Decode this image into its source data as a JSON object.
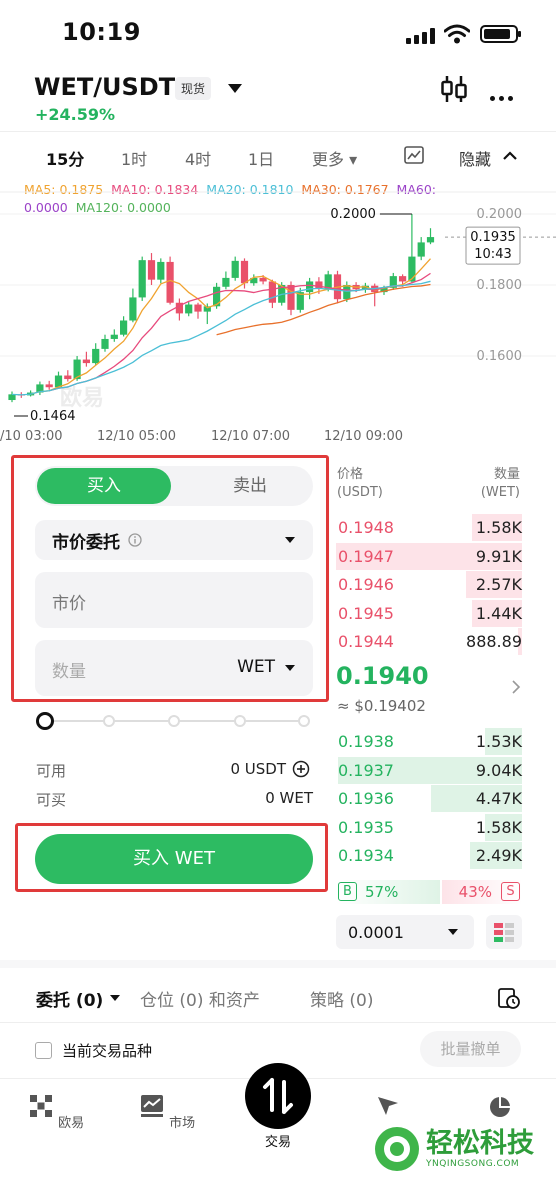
{
  "status": {
    "time": "10:19"
  },
  "header": {
    "pair": "WET/USDT",
    "badge": "现货",
    "change": "+24.59%"
  },
  "timeframes": [
    "15分",
    "1时",
    "4时",
    "1日",
    "更多 ▾"
  ],
  "hide_label": "隐藏",
  "ma": {
    "ma5": "MA5: 0.1875",
    "ma10": "MA10: 0.1834",
    "ma20": "MA20: 0.1810",
    "ma30": "MA30: 0.1767",
    "ma60_a": "MA60:",
    "ma60_b": "0.0000",
    "ma120": "MA120: 0.0000"
  },
  "colors": {
    "green": "#2dbb62",
    "red": "#e9516a",
    "ma5": "#f0a330",
    "ma10": "#e74a7d",
    "ma20": "#4bbfd6",
    "ma30": "#e8712c",
    "ma60": "#9b43c8",
    "ma120": "#54b35b"
  },
  "chart_data": {
    "type": "candlestick",
    "y_ticks": [
      "0.2000",
      "0.1800",
      "0.1600"
    ],
    "x_ticks": [
      "/10 03:00",
      "12/10 05:00",
      "12/10 07:00",
      "12/10 09:00"
    ],
    "high_label": "0.2000",
    "low_label": "0.1464",
    "price_tag": "0.1935",
    "countdown": "10:43",
    "watermark": "欧易",
    "candles": [
      [
        0.1476,
        0.1492,
        0.15,
        0.147
      ],
      [
        0.1492,
        0.1489,
        0.1498,
        0.1482
      ],
      [
        0.1489,
        0.1497,
        0.1503,
        0.1486
      ],
      [
        0.1497,
        0.152,
        0.1528,
        0.149
      ],
      [
        0.152,
        0.1512,
        0.153,
        0.1505
      ],
      [
        0.1512,
        0.1545,
        0.1556,
        0.1508
      ],
      [
        0.1545,
        0.1535,
        0.156,
        0.1528
      ],
      [
        0.1535,
        0.159,
        0.16,
        0.153
      ],
      [
        0.159,
        0.158,
        0.1612,
        0.157
      ],
      [
        0.158,
        0.162,
        0.1636,
        0.1575
      ],
      [
        0.162,
        0.1648,
        0.166,
        0.1612
      ],
      [
        0.1648,
        0.166,
        0.1675,
        0.164
      ],
      [
        0.166,
        0.17,
        0.1712,
        0.1655
      ],
      [
        0.17,
        0.1765,
        0.179,
        0.1695
      ],
      [
        0.1765,
        0.187,
        0.188,
        0.1755
      ],
      [
        0.187,
        0.1815,
        0.189,
        0.18
      ],
      [
        0.1815,
        0.1865,
        0.1875,
        0.1805
      ],
      [
        0.1865,
        0.175,
        0.188,
        0.1745
      ],
      [
        0.175,
        0.172,
        0.1762,
        0.17
      ],
      [
        0.172,
        0.1745,
        0.1752,
        0.1712
      ],
      [
        0.1745,
        0.1725,
        0.175,
        0.1705
      ],
      [
        0.1725,
        0.174,
        0.1748,
        0.169
      ],
      [
        0.174,
        0.1795,
        0.1806,
        0.1733
      ],
      [
        0.1795,
        0.182,
        0.1838,
        0.1788
      ],
      [
        0.182,
        0.1868,
        0.188,
        0.1812
      ],
      [
        0.1868,
        0.1805,
        0.1875,
        0.179
      ],
      [
        0.1805,
        0.182,
        0.183,
        0.1798
      ],
      [
        0.182,
        0.181,
        0.1828,
        0.1802
      ],
      [
        0.181,
        0.175,
        0.1815,
        0.1735
      ],
      [
        0.175,
        0.18,
        0.1808,
        0.1742
      ],
      [
        0.18,
        0.173,
        0.181,
        0.1715
      ],
      [
        0.173,
        0.178,
        0.1792,
        0.1722
      ],
      [
        0.178,
        0.181,
        0.182,
        0.176
      ],
      [
        0.181,
        0.179,
        0.1822,
        0.1775
      ],
      [
        0.179,
        0.183,
        0.184,
        0.1782
      ],
      [
        0.183,
        0.176,
        0.184,
        0.1748
      ],
      [
        0.176,
        0.18,
        0.181,
        0.1752
      ],
      [
        0.18,
        0.1788,
        0.1808,
        0.178
      ],
      [
        0.1788,
        0.1798,
        0.1806,
        0.1778
      ],
      [
        0.1798,
        0.178,
        0.1804,
        0.174
      ],
      [
        0.178,
        0.1792,
        0.1798,
        0.1772
      ],
      [
        0.1792,
        0.1825,
        0.1834,
        0.1786
      ],
      [
        0.1825,
        0.181,
        0.183,
        0.1795
      ],
      [
        0.181,
        0.188,
        0.2,
        0.1805
      ],
      [
        0.188,
        0.192,
        0.1935,
        0.187
      ],
      [
        0.192,
        0.1935,
        0.196,
        0.1915
      ]
    ]
  },
  "form": {
    "buy_tab": "买入",
    "sell_tab": "卖出",
    "order_type": "市价委托",
    "price_placeholder": "市价",
    "amount_placeholder": "数量",
    "amount_unit": "WET",
    "avail_label": "可用",
    "avail_value": "0 USDT",
    "canbuy_label": "可买",
    "canbuy_value": "0 WET",
    "buy_button": "买入 WET"
  },
  "orderbook": {
    "price_header": "价格",
    "price_unit": "(USDT)",
    "qty_header": "数量",
    "qty_unit": "(WET)",
    "asks": [
      {
        "price": "0.1948",
        "qty": "1.58K",
        "depth": 0.27
      },
      {
        "price": "0.1947",
        "qty": "9.91K",
        "depth": 1.0
      },
      {
        "price": "0.1946",
        "qty": "2.57K",
        "depth": 0.3
      },
      {
        "price": "0.1945",
        "qty": "1.44K",
        "depth": 0.27
      },
      {
        "price": "0.1944",
        "qty": "888.89",
        "depth": 0.02
      }
    ],
    "last_price": "0.1940",
    "last_usd": "≈ $0.19402",
    "bids": [
      {
        "price": "0.1938",
        "qty": "1.53K",
        "depth": 0.2
      },
      {
        "price": "0.1937",
        "qty": "9.04K",
        "depth": 0.99
      },
      {
        "price": "0.1936",
        "qty": "4.47K",
        "depth": 0.49
      },
      {
        "price": "0.1935",
        "qty": "1.58K",
        "depth": 0.2
      },
      {
        "price": "0.1934",
        "qty": "2.49K",
        "depth": 0.28
      }
    ],
    "buy_ratio_label": "B",
    "buy_ratio": "57%",
    "sell_ratio": "43%",
    "sell_ratio_label": "S",
    "tick_size": "0.0001"
  },
  "orders_tabs": {
    "orders": "委托 (0)",
    "positions": "仓位 (0) 和资产",
    "strategy": "策略 (0)"
  },
  "filter_label": "当前交易品种",
  "batch_cancel": "批量撤单",
  "tabbar": {
    "home": "欧易",
    "market": "市场",
    "trade": "交易"
  },
  "watermark_site": {
    "name": "轻松科技",
    "url": "YNQINGSONG.COM"
  }
}
